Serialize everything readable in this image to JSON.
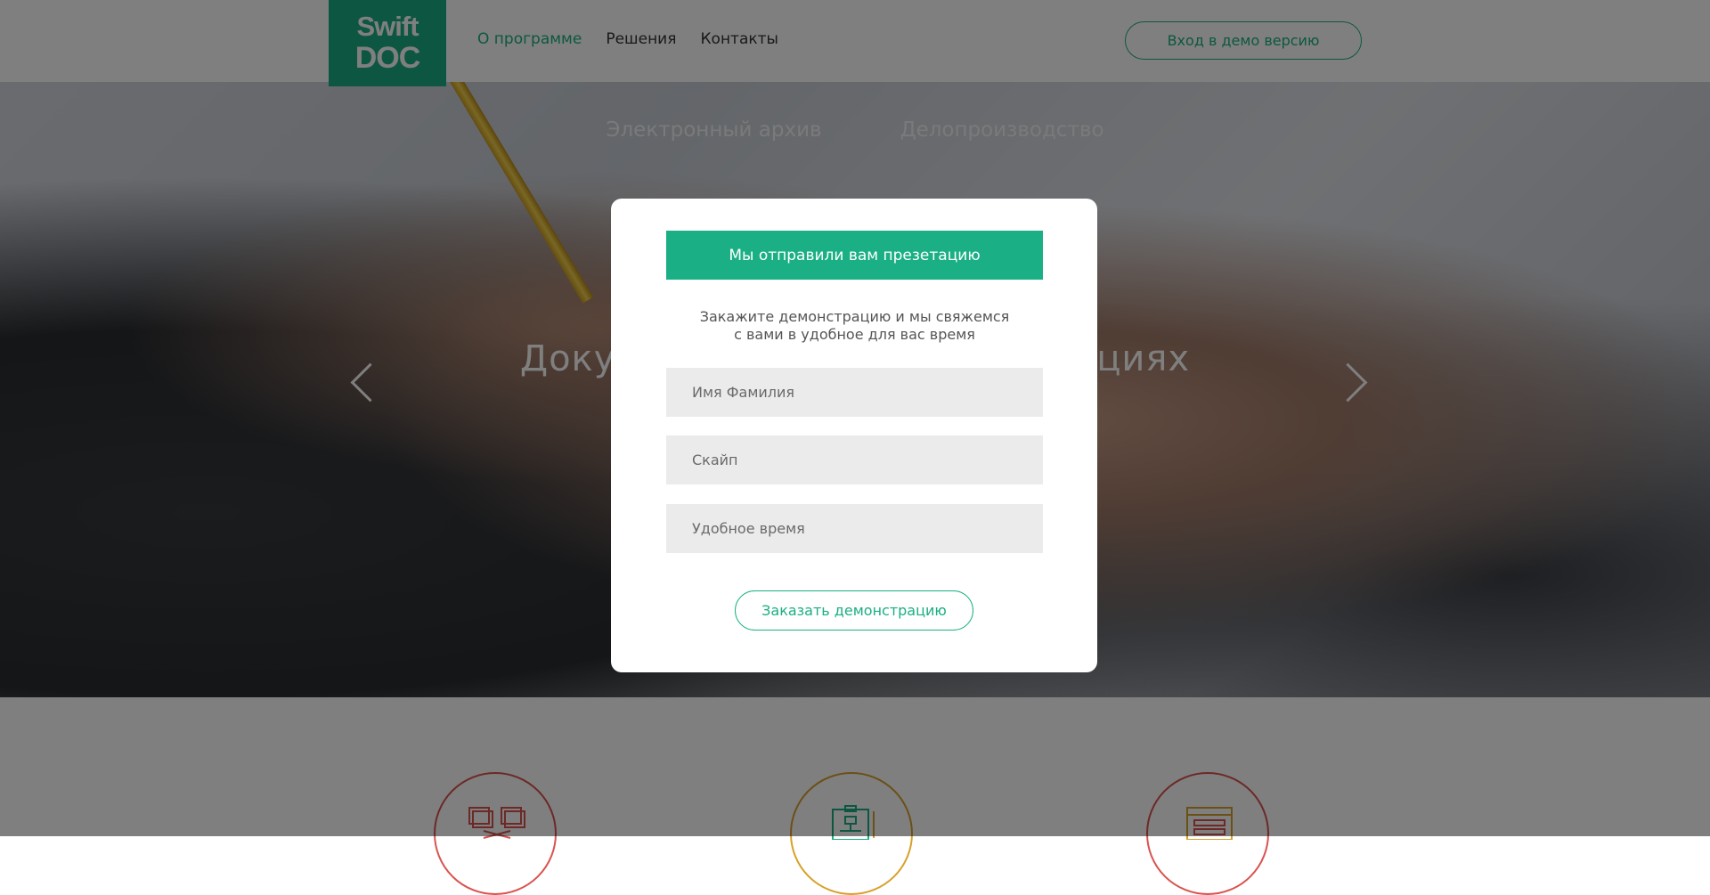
{
  "header": {
    "logo_line1": "Swift",
    "logo_line2": "DOC",
    "nav": [
      {
        "label": "О программе",
        "active": true
      },
      {
        "label": "Решения",
        "active": false
      },
      {
        "label": "Контакты",
        "active": false
      }
    ],
    "demo_login_label": "Вход в демо версию"
  },
  "hero": {
    "tabs": [
      "Электронный архив",
      "Делопроизводство"
    ],
    "title": "Документооборот в организациях",
    "prev_icon": "chevron-left-icon",
    "next_icon": "chevron-right-icon"
  },
  "features": {
    "icons": [
      "documents-exchange-icon",
      "org-chart-clipboard-icon",
      "browser-window-icon"
    ],
    "colors": [
      "#d9534f",
      "#d7a12a",
      "#d9534f"
    ]
  },
  "modal": {
    "banner": "Мы отправили вам презетацию",
    "text_line1": "Закажите демонстрацию и мы свяжемся",
    "text_line2": "с вами в удобное для вас время",
    "fields": {
      "name_placeholder": "Имя Фамилия",
      "skype_placeholder": "Скайп",
      "time_placeholder": "Удобное время"
    },
    "submit_label": "Заказать демонстрацию"
  },
  "colors": {
    "accent": "#1aaf84",
    "overlay": "rgba(0,0,0,0.5)"
  }
}
